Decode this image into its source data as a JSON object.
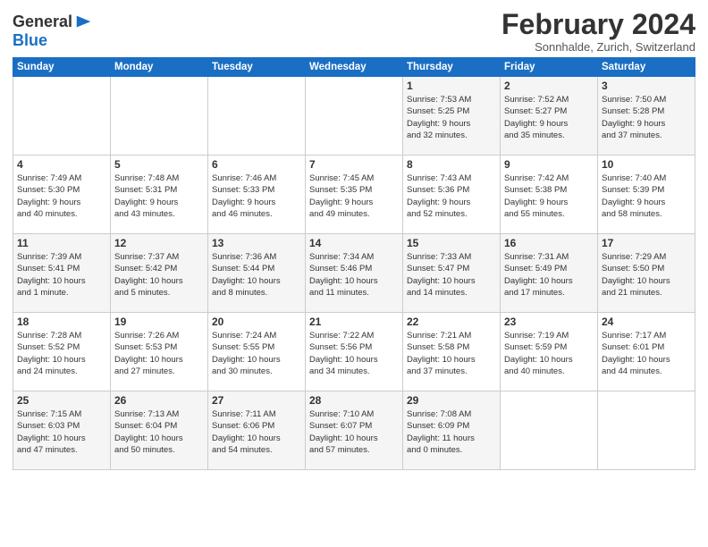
{
  "header": {
    "logo_line1": "General",
    "logo_line2": "Blue",
    "title": "February 2024",
    "subtitle": "Sonnhalde, Zurich, Switzerland"
  },
  "days_of_week": [
    "Sunday",
    "Monday",
    "Tuesday",
    "Wednesday",
    "Thursday",
    "Friday",
    "Saturday"
  ],
  "weeks": [
    [
      {
        "num": "",
        "info": ""
      },
      {
        "num": "",
        "info": ""
      },
      {
        "num": "",
        "info": ""
      },
      {
        "num": "",
        "info": ""
      },
      {
        "num": "1",
        "info": "Sunrise: 7:53 AM\nSunset: 5:25 PM\nDaylight: 9 hours\nand 32 minutes."
      },
      {
        "num": "2",
        "info": "Sunrise: 7:52 AM\nSunset: 5:27 PM\nDaylight: 9 hours\nand 35 minutes."
      },
      {
        "num": "3",
        "info": "Sunrise: 7:50 AM\nSunset: 5:28 PM\nDaylight: 9 hours\nand 37 minutes."
      }
    ],
    [
      {
        "num": "4",
        "info": "Sunrise: 7:49 AM\nSunset: 5:30 PM\nDaylight: 9 hours\nand 40 minutes."
      },
      {
        "num": "5",
        "info": "Sunrise: 7:48 AM\nSunset: 5:31 PM\nDaylight: 9 hours\nand 43 minutes."
      },
      {
        "num": "6",
        "info": "Sunrise: 7:46 AM\nSunset: 5:33 PM\nDaylight: 9 hours\nand 46 minutes."
      },
      {
        "num": "7",
        "info": "Sunrise: 7:45 AM\nSunset: 5:35 PM\nDaylight: 9 hours\nand 49 minutes."
      },
      {
        "num": "8",
        "info": "Sunrise: 7:43 AM\nSunset: 5:36 PM\nDaylight: 9 hours\nand 52 minutes."
      },
      {
        "num": "9",
        "info": "Sunrise: 7:42 AM\nSunset: 5:38 PM\nDaylight: 9 hours\nand 55 minutes."
      },
      {
        "num": "10",
        "info": "Sunrise: 7:40 AM\nSunset: 5:39 PM\nDaylight: 9 hours\nand 58 minutes."
      }
    ],
    [
      {
        "num": "11",
        "info": "Sunrise: 7:39 AM\nSunset: 5:41 PM\nDaylight: 10 hours\nand 1 minute."
      },
      {
        "num": "12",
        "info": "Sunrise: 7:37 AM\nSunset: 5:42 PM\nDaylight: 10 hours\nand 5 minutes."
      },
      {
        "num": "13",
        "info": "Sunrise: 7:36 AM\nSunset: 5:44 PM\nDaylight: 10 hours\nand 8 minutes."
      },
      {
        "num": "14",
        "info": "Sunrise: 7:34 AM\nSunset: 5:46 PM\nDaylight: 10 hours\nand 11 minutes."
      },
      {
        "num": "15",
        "info": "Sunrise: 7:33 AM\nSunset: 5:47 PM\nDaylight: 10 hours\nand 14 minutes."
      },
      {
        "num": "16",
        "info": "Sunrise: 7:31 AM\nSunset: 5:49 PM\nDaylight: 10 hours\nand 17 minutes."
      },
      {
        "num": "17",
        "info": "Sunrise: 7:29 AM\nSunset: 5:50 PM\nDaylight: 10 hours\nand 21 minutes."
      }
    ],
    [
      {
        "num": "18",
        "info": "Sunrise: 7:28 AM\nSunset: 5:52 PM\nDaylight: 10 hours\nand 24 minutes."
      },
      {
        "num": "19",
        "info": "Sunrise: 7:26 AM\nSunset: 5:53 PM\nDaylight: 10 hours\nand 27 minutes."
      },
      {
        "num": "20",
        "info": "Sunrise: 7:24 AM\nSunset: 5:55 PM\nDaylight: 10 hours\nand 30 minutes."
      },
      {
        "num": "21",
        "info": "Sunrise: 7:22 AM\nSunset: 5:56 PM\nDaylight: 10 hours\nand 34 minutes."
      },
      {
        "num": "22",
        "info": "Sunrise: 7:21 AM\nSunset: 5:58 PM\nDaylight: 10 hours\nand 37 minutes."
      },
      {
        "num": "23",
        "info": "Sunrise: 7:19 AM\nSunset: 5:59 PM\nDaylight: 10 hours\nand 40 minutes."
      },
      {
        "num": "24",
        "info": "Sunrise: 7:17 AM\nSunset: 6:01 PM\nDaylight: 10 hours\nand 44 minutes."
      }
    ],
    [
      {
        "num": "25",
        "info": "Sunrise: 7:15 AM\nSunset: 6:03 PM\nDaylight: 10 hours\nand 47 minutes."
      },
      {
        "num": "26",
        "info": "Sunrise: 7:13 AM\nSunset: 6:04 PM\nDaylight: 10 hours\nand 50 minutes."
      },
      {
        "num": "27",
        "info": "Sunrise: 7:11 AM\nSunset: 6:06 PM\nDaylight: 10 hours\nand 54 minutes."
      },
      {
        "num": "28",
        "info": "Sunrise: 7:10 AM\nSunset: 6:07 PM\nDaylight: 10 hours\nand 57 minutes."
      },
      {
        "num": "29",
        "info": "Sunrise: 7:08 AM\nSunset: 6:09 PM\nDaylight: 11 hours\nand 0 minutes."
      },
      {
        "num": "",
        "info": ""
      },
      {
        "num": "",
        "info": ""
      }
    ]
  ]
}
